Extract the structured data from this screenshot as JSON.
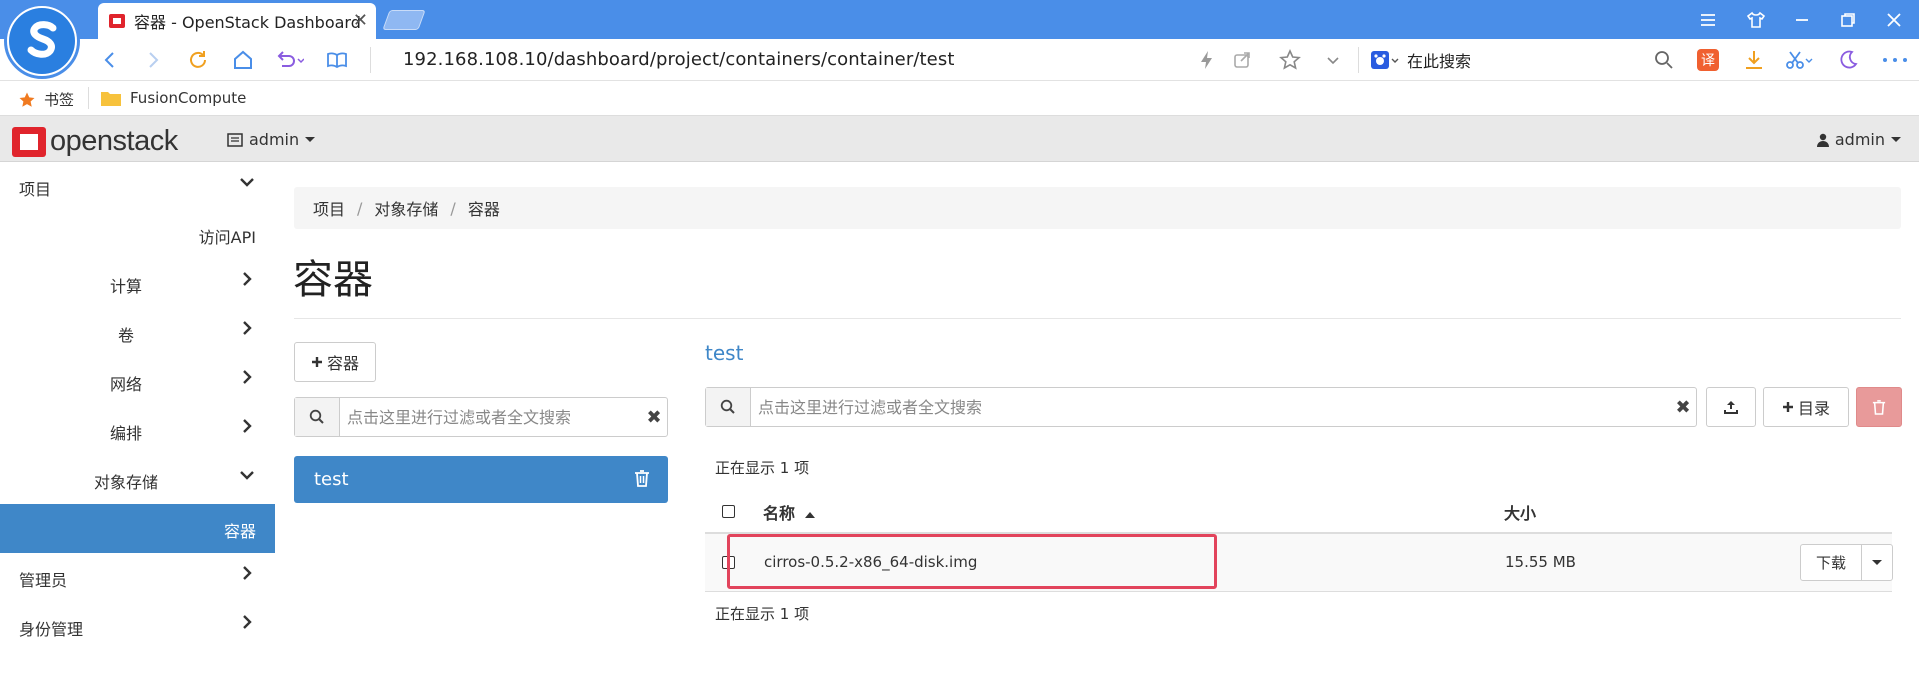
{
  "browser": {
    "tab_title": "容器 - OpenStack Dashboard",
    "tab_close": "✕",
    "url": "192.168.108.10/dashboard/project/containers/container/test",
    "search_engine_label": "在此搜索"
  },
  "bookmarks": [
    {
      "label": "书签"
    },
    {
      "label": "FusionCompute"
    }
  ],
  "header": {
    "brand": "openstack",
    "project_selector": "admin",
    "user_menu": "admin"
  },
  "sidebar": {
    "items": [
      {
        "label": "项目",
        "chevron": "down"
      },
      {
        "label": "访问API"
      },
      {
        "label": "计算",
        "chevron": "right"
      },
      {
        "label": "卷",
        "chevron": "right"
      },
      {
        "label": "网络",
        "chevron": "right"
      },
      {
        "label": "编排",
        "chevron": "right"
      },
      {
        "label": "对象存储",
        "chevron": "down"
      },
      {
        "label": "容器",
        "active": true
      },
      {
        "label": "管理员",
        "chevron": "right"
      },
      {
        "label": "身份管理",
        "chevron": "right"
      }
    ]
  },
  "breadcrumb": [
    "项目",
    "对象存储",
    "容器"
  ],
  "page": {
    "title": "容器"
  },
  "containers_panel": {
    "add_button": "容器",
    "filter_placeholder": "点击这里进行过滤或者全文搜索",
    "items": [
      {
        "name": "test"
      }
    ]
  },
  "objects_panel": {
    "title": "test",
    "filter_placeholder": "点击这里进行过滤或者全文搜索",
    "add_folder_button": "目录",
    "showing_top": "正在显示 1 项",
    "showing_bottom": "正在显示 1 项",
    "columns": {
      "name": "名称",
      "size": "大小"
    },
    "rows": [
      {
        "name": "cirros-0.5.2-x86_64-disk.img",
        "size": "15.55 MB",
        "action": "下载"
      }
    ]
  },
  "colors": {
    "browser_blue": "#4a8ee8",
    "accent_blue": "#3f87c8",
    "danger": "#e89a9a",
    "highlight_red": "#e2445c"
  }
}
